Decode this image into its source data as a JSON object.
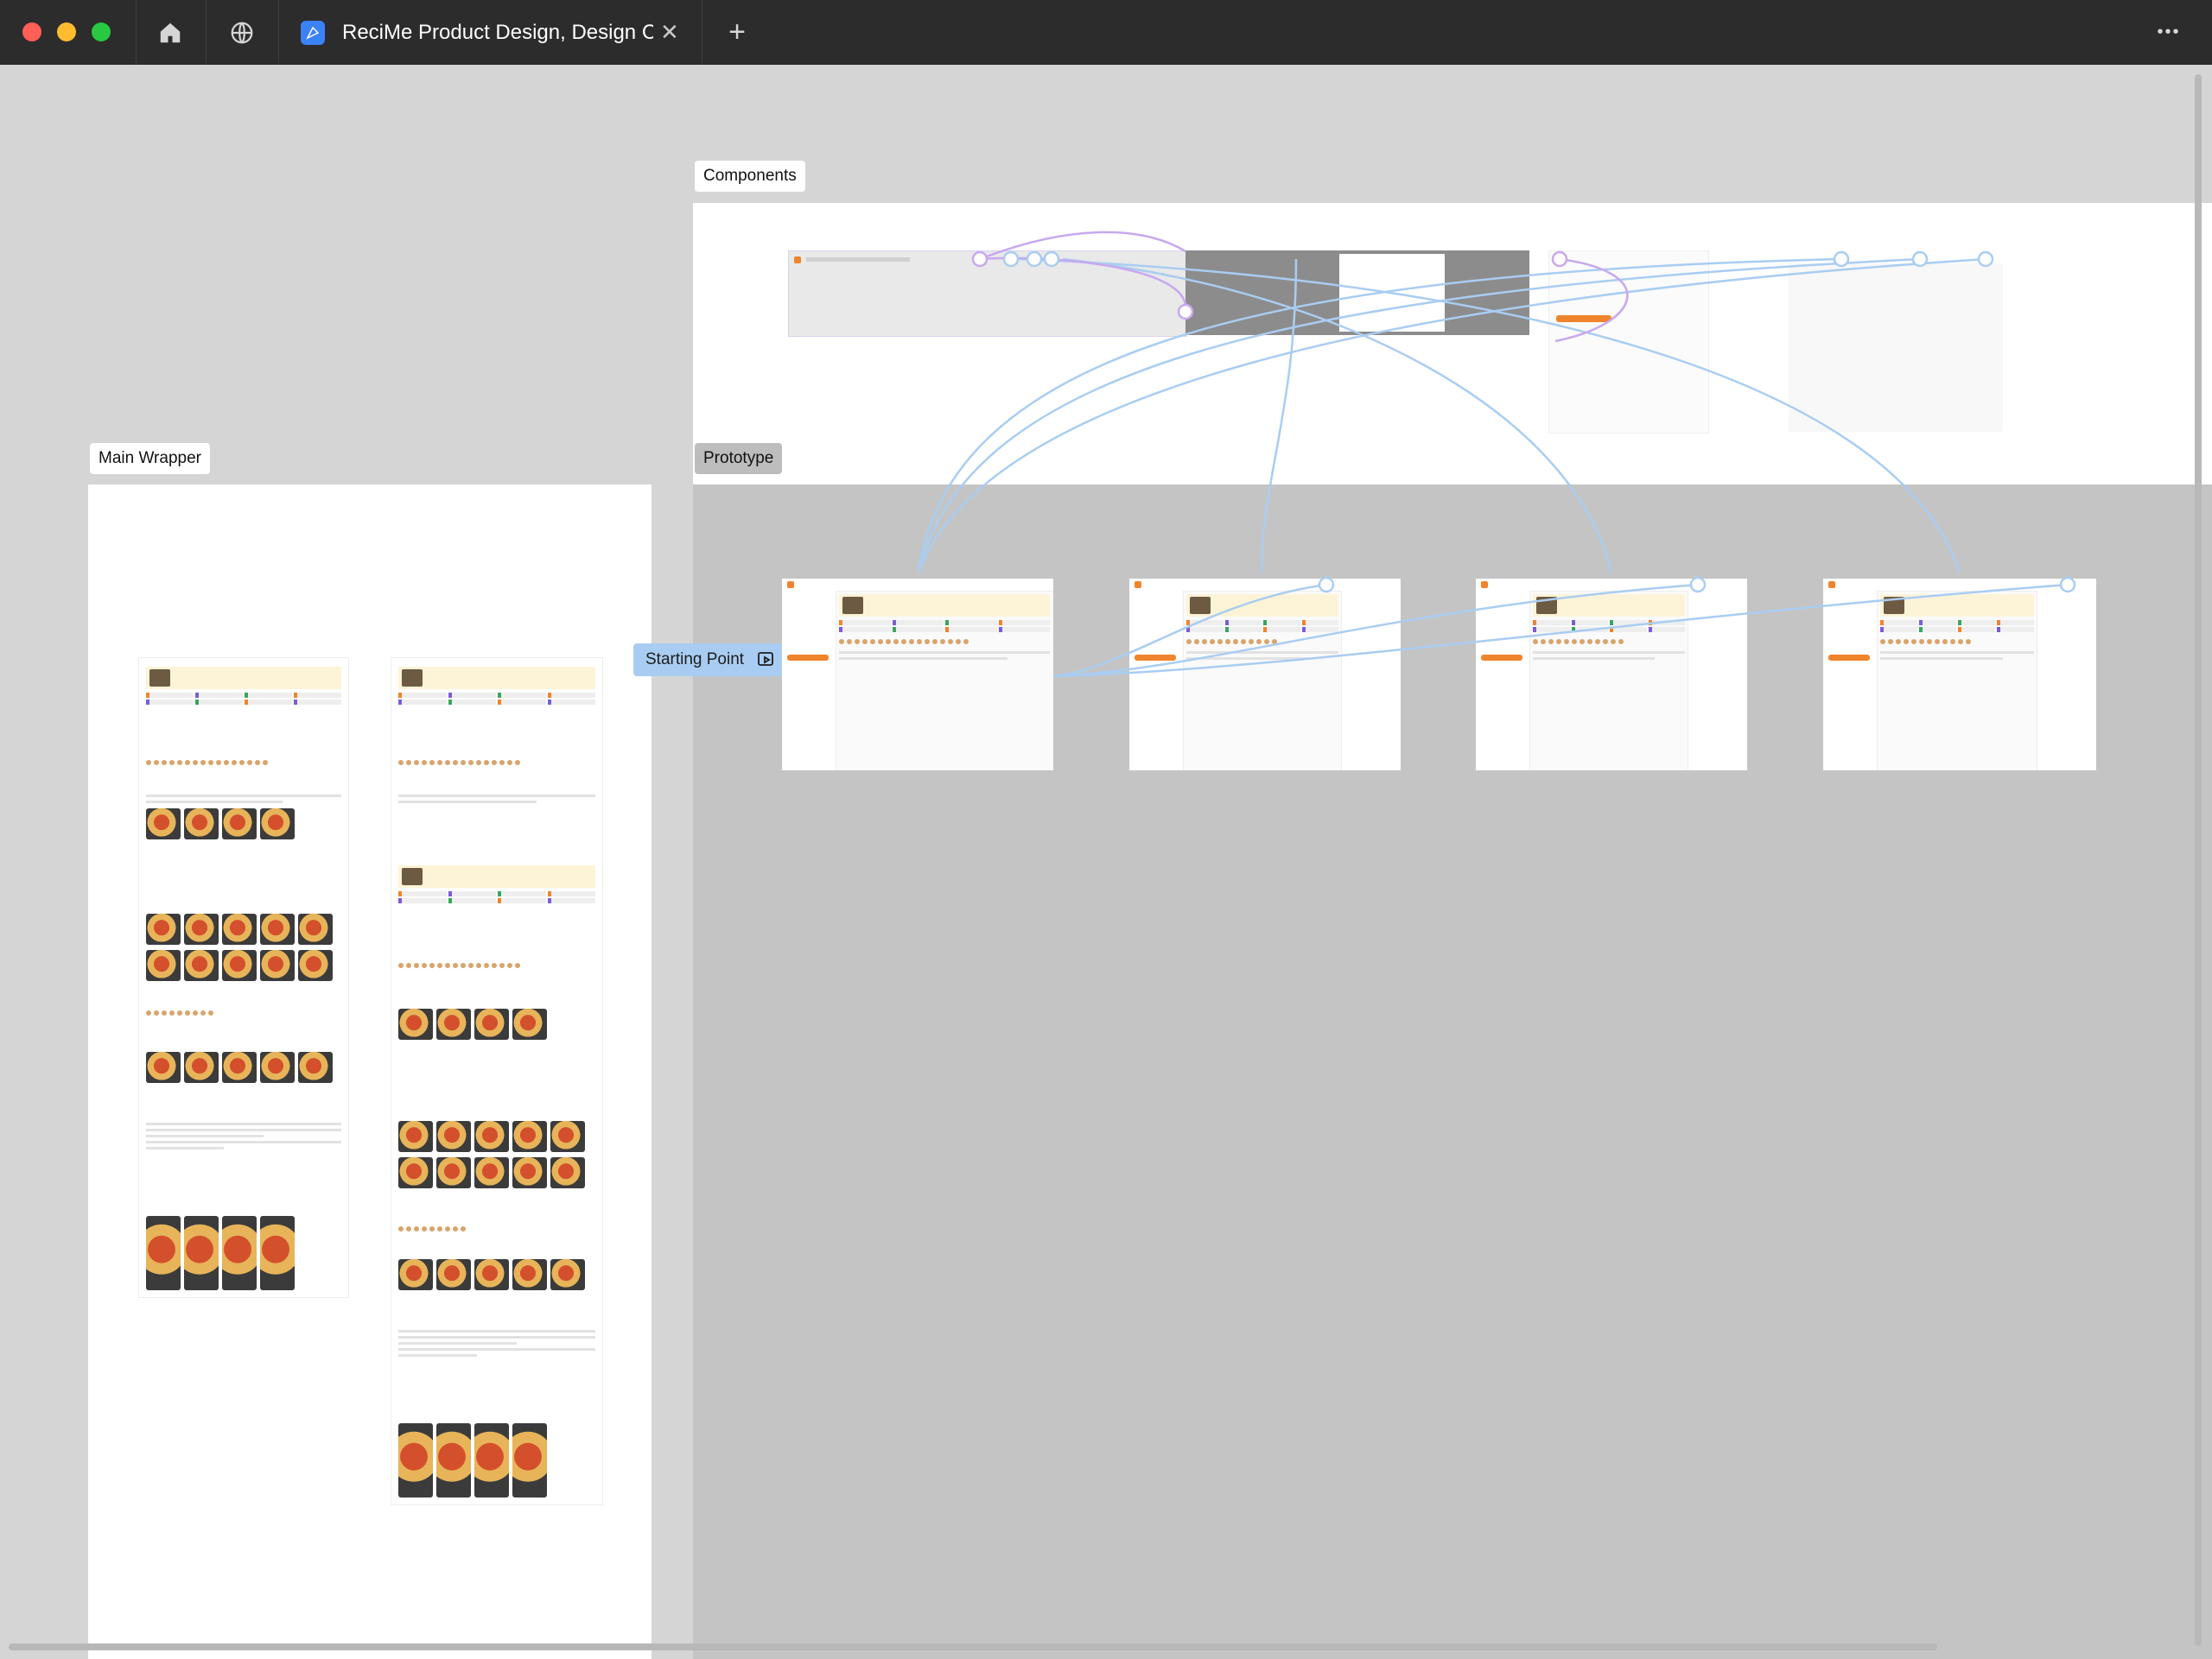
{
  "window": {
    "tab_title": "ReciMe Product Design, Design Ch",
    "new_tab": "+",
    "more": "•••"
  },
  "canvas": {
    "labels": {
      "components": "Components",
      "main_wrapper": "Main Wrapper",
      "prototype": "Prototype",
      "starting_point": "Starting Point"
    }
  },
  "colors": {
    "chrome": "#2c2c2c",
    "canvas": "#d5d5d5",
    "brand_orange": "#f0842c",
    "connector": "#a9cdf2",
    "component_connector": "#c8a8f0"
  },
  "icons": [
    "home-icon",
    "globe-icon",
    "figma-file-icon",
    "close-icon",
    "plus-icon",
    "more-icon",
    "play-frame-icon"
  ]
}
